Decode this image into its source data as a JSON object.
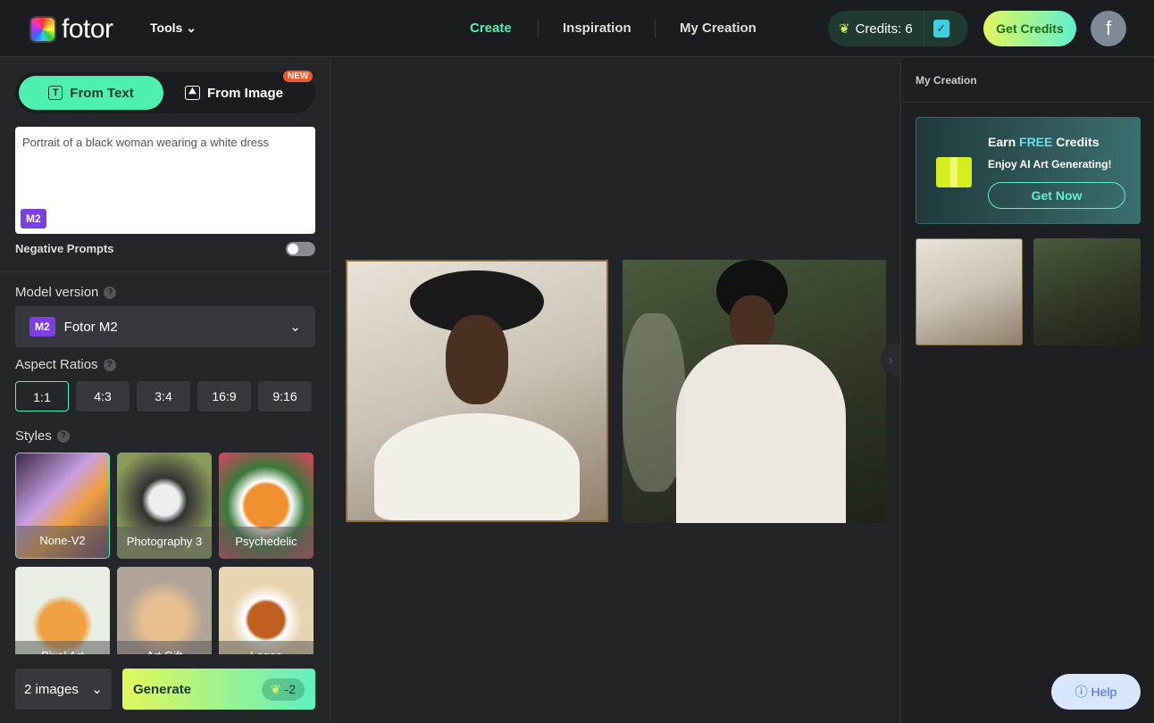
{
  "header": {
    "logo": "fotor",
    "tools": "Tools",
    "nav": [
      "Create",
      "Inspiration",
      "My Creation"
    ],
    "credits": "Credits: 6",
    "get_credits": "Get Credits",
    "avatar": "f"
  },
  "left": {
    "mode_text": "From Text",
    "mode_image": "From Image",
    "new_badge": "NEW",
    "prompt": "Portrait of a black woman wearing a white dress",
    "model_badge": "M2",
    "negative_prompts": "Negative Prompts",
    "negative_enabled": false,
    "model_label": "Model version",
    "model_value": "Fotor M2",
    "aspect_label": "Aspect Ratios",
    "aspects": [
      "1:1",
      "4:3",
      "3:4",
      "16:9",
      "9:16"
    ],
    "aspect_selected": "1:1",
    "styles_label": "Styles",
    "styles": [
      "None-V2",
      "Photography 3",
      "Psychedelic",
      "Pixel Art",
      "Art Gift",
      "Logos"
    ],
    "count": "2 images",
    "generate": "Generate",
    "cost": "-2"
  },
  "right": {
    "title": "My Creation",
    "earn_1": "Earn",
    "earn_free": "FREE",
    "earn_2": "Credits",
    "earn_sub": "Enjoy AI Art Generating!",
    "get_now": "Get Now",
    "help": "Help"
  },
  "colors": {
    "accent": "#4ef0b0",
    "purple": "#7b3fe4",
    "new": "#ee5b2a"
  }
}
